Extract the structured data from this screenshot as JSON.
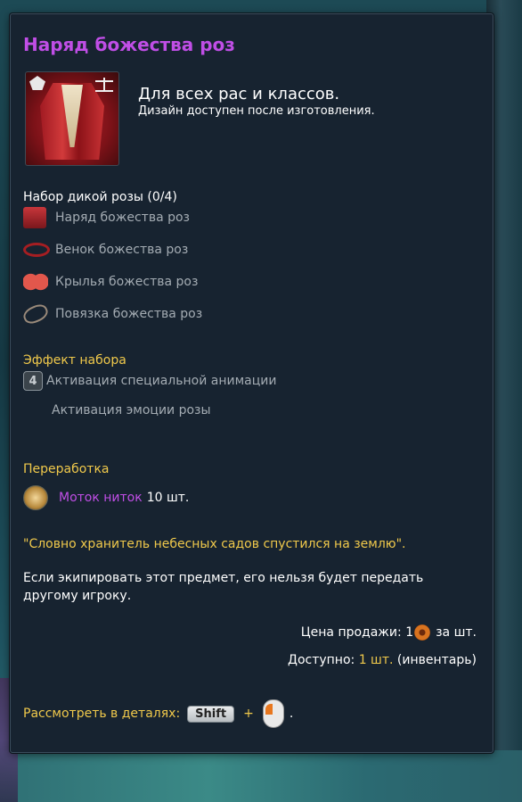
{
  "tooltip": {
    "title": "Наряд божества роз",
    "race_class": "Для всех рас и классов.",
    "design_note": "Дизайн доступен после изготовления.",
    "set": {
      "title": "Набор дикой розы (0/4)",
      "items": [
        {
          "label": "Наряд божества роз",
          "icon": "outfit-icon"
        },
        {
          "label": "Венок божества роз",
          "icon": "wreath-icon"
        },
        {
          "label": "Крылья божества роз",
          "icon": "wings-icon"
        },
        {
          "label": "Повязка божества роз",
          "icon": "headband-icon"
        }
      ]
    },
    "set_effect": {
      "title": "Эффект набора",
      "count": "4",
      "line1": "Активация специальной анимации",
      "line2": "Активация эмоции розы"
    },
    "rework": {
      "title": "Переработка",
      "item_name": "Моток ниток",
      "quantity": "10 шт."
    },
    "quote": "\"Словно хранитель небесных садов спустился на землю\".",
    "description": "Если экипировать этот предмет, его нельзя будет передать другому игроку.",
    "sell_price": {
      "label": "Цена продажи: 1",
      "unit": "за шт."
    },
    "available": {
      "label": "Доступно:",
      "value": "1 шт.",
      "suffix": "(инвентарь)"
    },
    "details": {
      "label": "Рассмотреть в деталях:",
      "key": "Shift",
      "plus": "+",
      "end": "."
    }
  },
  "colors": {
    "title_purple": "#c04ee6",
    "accent_yellow": "#f0c94b",
    "muted_text": "#a4acb3",
    "panel_bg": "#172330"
  }
}
